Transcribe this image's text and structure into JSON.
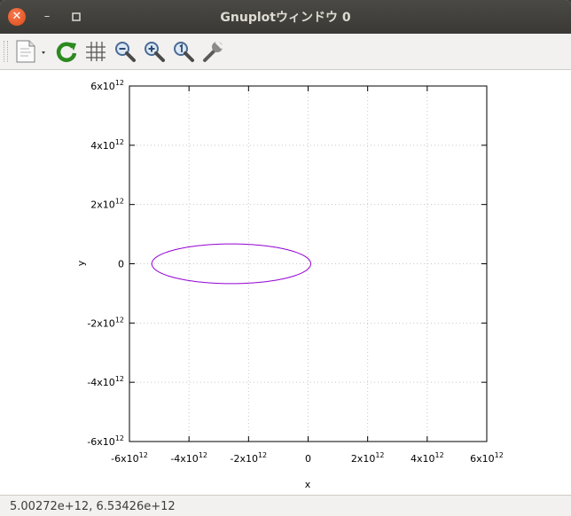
{
  "window": {
    "title": "Gnuplotウィンドウ 0",
    "close_glyph": "✕",
    "minimize_glyph": "–",
    "maximize_glyph": "□"
  },
  "toolbar": {
    "buttons": [
      {
        "name": "copy-to-clipboard",
        "icon": "document-icon"
      },
      {
        "name": "replot",
        "icon": "refresh-icon"
      },
      {
        "name": "toggle-grid",
        "icon": "grid-icon"
      },
      {
        "name": "previous-zoom",
        "icon": "zoom-out-icon"
      },
      {
        "name": "next-zoom",
        "icon": "zoom-in-icon"
      },
      {
        "name": "autoscale",
        "icon": "zoom-fit-icon"
      },
      {
        "name": "config",
        "icon": "wrench-icon"
      }
    ]
  },
  "chart_data": {
    "type": "line",
    "xlabel": "x",
    "ylabel": "y",
    "xlim": [
      -6000000000000.0,
      6000000000000.0
    ],
    "ylim": [
      -6000000000000.0,
      6000000000000.0
    ],
    "grid": true,
    "xticks": [
      {
        "value": -6000000000000.0,
        "base": "-6x10",
        "exp": "12"
      },
      {
        "value": -4000000000000.0,
        "base": "-4x10",
        "exp": "12"
      },
      {
        "value": -2000000000000.0,
        "base": "-2x10",
        "exp": "12"
      },
      {
        "value": 0,
        "base": "0",
        "exp": ""
      },
      {
        "value": 2000000000000.0,
        "base": "2x10",
        "exp": "12"
      },
      {
        "value": 4000000000000.0,
        "base": "4x10",
        "exp": "12"
      },
      {
        "value": 6000000000000.0,
        "base": "6x10",
        "exp": "12"
      }
    ],
    "yticks": [
      {
        "value": 6000000000000.0,
        "base": "6x10",
        "exp": "12"
      },
      {
        "value": 4000000000000.0,
        "base": "4x10",
        "exp": "12"
      },
      {
        "value": 2000000000000.0,
        "base": "2x10",
        "exp": "12"
      },
      {
        "value": 0,
        "base": "0",
        "exp": ""
      },
      {
        "value": -2000000000000.0,
        "base": "-2x10",
        "exp": "12"
      },
      {
        "value": -4000000000000.0,
        "base": "-4x10",
        "exp": "12"
      },
      {
        "value": -6000000000000.0,
        "base": "-6x10",
        "exp": "12"
      }
    ],
    "series": [
      {
        "color": "#9400d3",
        "orbit": {
          "center_x": -2580000000000.0,
          "center_y": 0,
          "semi_major": 2670000000000.0,
          "semi_minor": 670000000000.0
        }
      }
    ]
  },
  "statusbar": {
    "coordinates": "5.00272e+12,  6.53426e+12"
  }
}
